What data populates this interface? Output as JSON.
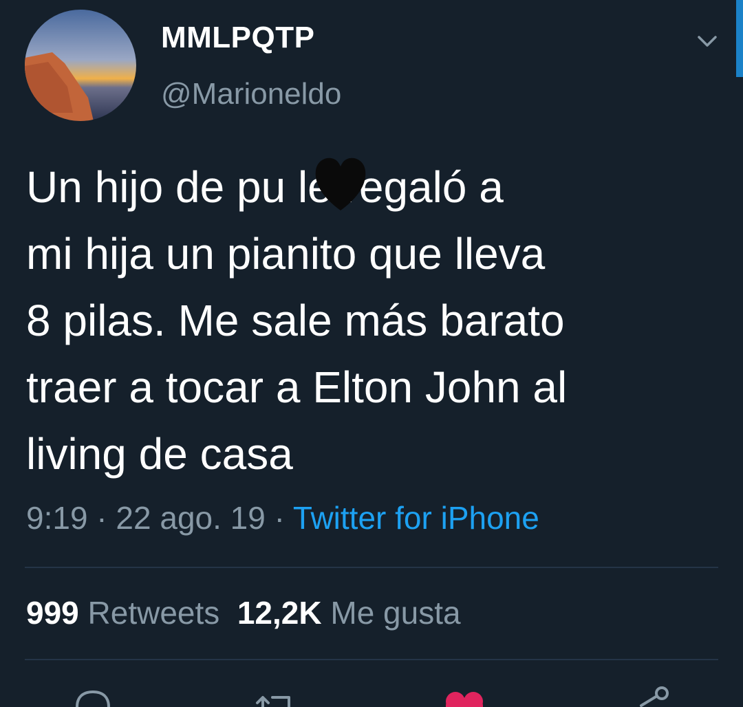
{
  "user": {
    "display_name": "MMLPQTP",
    "handle": "@Marioneldo"
  },
  "tweet": {
    "text_line1_pre": "Un hijo de pu",
    "text_line1_post": " le regaló a",
    "text_rest": "mi hija un pianito que lleva\n8 pilas. Me sale más barato\ntraer a tocar a Elton John al\nliving de casa"
  },
  "meta": {
    "time": "9:19",
    "sep1": " · ",
    "date": "22 ago. 19",
    "sep2": " · ",
    "source": "Twitter for iPhone"
  },
  "stats": {
    "retweets_count": "999",
    "retweets_label": "Retweets",
    "likes_count": "12,2K",
    "likes_label": "Me gusta"
  },
  "icons": {
    "more": "chevron-down-icon",
    "reply": "reply-icon",
    "retweet": "retweet-icon",
    "like": "heart-icon",
    "share": "share-icon"
  },
  "colors": {
    "background": "#15202b",
    "secondary_text": "#8899a6",
    "link": "#1da1f2",
    "like": "#e0245e"
  }
}
